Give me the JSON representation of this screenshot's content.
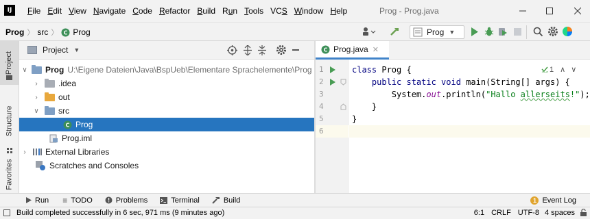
{
  "app": {
    "logo_text": "IJ",
    "window_title": "Prog - Prog.java"
  },
  "menu": [
    {
      "mnemonic": "F",
      "rest": "ile"
    },
    {
      "mnemonic": "E",
      "rest": "dit"
    },
    {
      "mnemonic": "V",
      "rest": "iew"
    },
    {
      "mnemonic": "N",
      "rest": "avigate"
    },
    {
      "mnemonic": "C",
      "rest": "ode"
    },
    {
      "mnemonic": "R",
      "rest": "efactor"
    },
    {
      "mnemonic": "B",
      "rest": "uild"
    },
    {
      "pre": "R",
      "mnemonic": "u",
      "rest": "n"
    },
    {
      "mnemonic": "T",
      "rest": "ools"
    },
    {
      "pre": "VC",
      "mnemonic": "S",
      "rest": ""
    },
    {
      "mnemonic": "W",
      "rest": "indow"
    },
    {
      "mnemonic": "H",
      "rest": "elp"
    }
  ],
  "breadcrumb": {
    "project": "Prog",
    "folder": "src",
    "file": "Prog"
  },
  "run_config": {
    "label": "Prog"
  },
  "stripe": {
    "project": "Project",
    "structure": "Structure",
    "favorites": "Favorites"
  },
  "project_panel": {
    "title": "Project",
    "tree": {
      "root_name": "Prog",
      "root_path": "U:\\Eigene Dateien\\Java\\BspUeb\\Elementare Sprachelemente\\Prog",
      "idea": ".idea",
      "out": "out",
      "src": "src",
      "prog_class": "Prog",
      "prog_iml": "Prog.iml",
      "external_libraries": "External Libraries",
      "scratches": "Scratches and Consoles"
    }
  },
  "editor": {
    "tab_label": "Prog.java",
    "line_numbers": [
      "1",
      "2",
      "3",
      "4",
      "5",
      "6"
    ],
    "inspection_count": "1",
    "code": {
      "l1_kw": "class",
      "l1_rest": " Prog {",
      "l2_kw1": "public static void",
      "l2_rest": " main(String[] args) {",
      "l3_pre": "System.",
      "l3_field": "out",
      "l3_mid": ".println(",
      "l3_str_a": "\"Hallo ",
      "l3_str_b": "allerseits",
      "l3_str_c": "!\"",
      "l3_end": ");",
      "l4": "}",
      "l5": "}"
    }
  },
  "tool_tabs": {
    "run": "Run",
    "todo": "TODO",
    "problems": "Problems",
    "terminal": "Terminal",
    "build": "Build",
    "event_log": "Event Log",
    "event_log_count": "1"
  },
  "status": {
    "message": "Build completed successfully in 6 sec, 971 ms (9 minutes ago)",
    "position": "6:1",
    "line_sep": "CRLF",
    "encoding": "UTF-8",
    "indent": "4 spaces"
  },
  "colors": {
    "selection": "#2675bf",
    "run_green": "#499c54",
    "keyword": "#000080",
    "string": "#067d17",
    "field": "#871094"
  }
}
